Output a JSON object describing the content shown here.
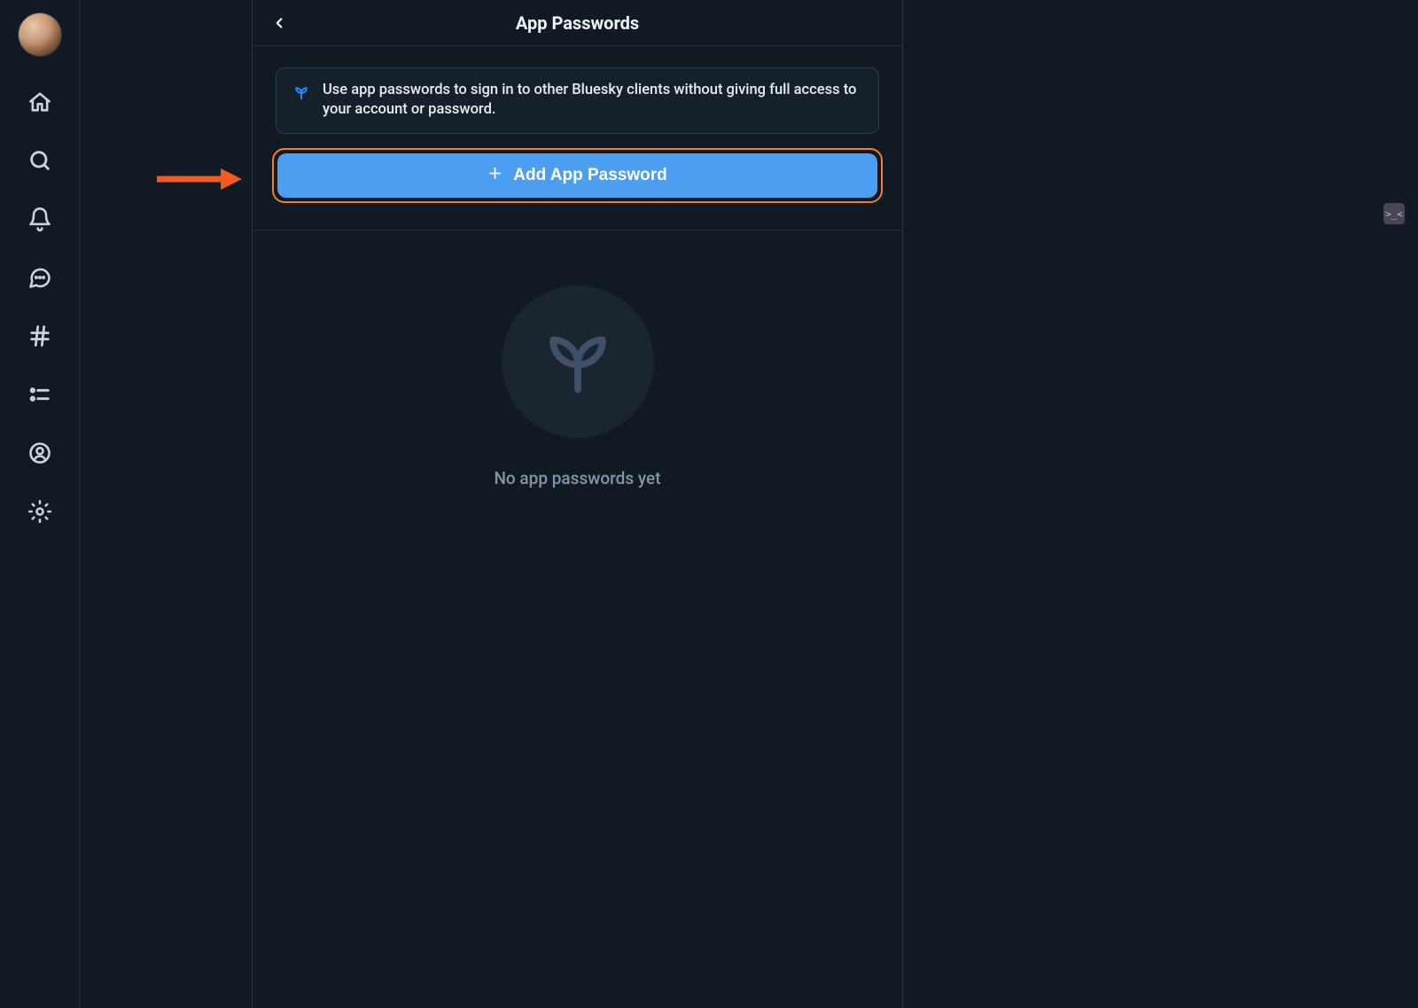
{
  "nav": {
    "items": [
      {
        "name": "home-icon"
      },
      {
        "name": "search-icon"
      },
      {
        "name": "bell-icon"
      },
      {
        "name": "chat-icon"
      },
      {
        "name": "hashtag-icon"
      },
      {
        "name": "list-icon"
      },
      {
        "name": "profile-icon"
      },
      {
        "name": "settings-icon"
      }
    ]
  },
  "header": {
    "title": "App Passwords"
  },
  "info": {
    "text": "Use app passwords to sign in to other Bluesky clients without giving full access to your account or password."
  },
  "add_button": {
    "label": "Add App Password"
  },
  "empty": {
    "message": "No app passwords yet"
  },
  "float_badge": {
    "label": ">_<"
  }
}
